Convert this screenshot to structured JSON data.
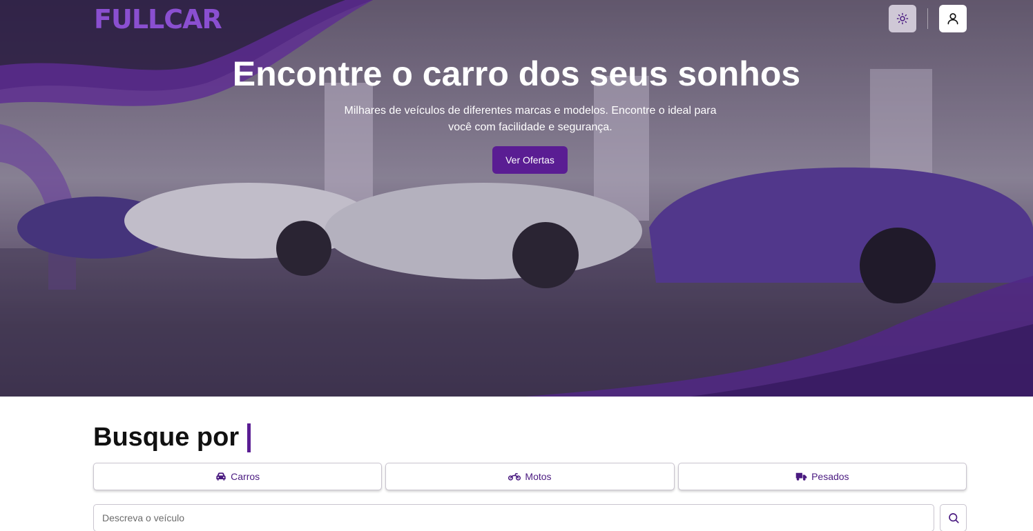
{
  "brand": {
    "logo_text": "FULLCAR"
  },
  "header": {
    "theme_icon": "sun-icon",
    "user_icon": "user-icon"
  },
  "hero": {
    "title": "Encontre o carro dos seus sonhos",
    "subtitle": "Milhares de veículos de diferentes marcas e modelos. Encontre o ideal para você com facilidade e segurança.",
    "cta_label": "Ver Ofertas"
  },
  "search": {
    "title": "Busque por",
    "tabs": [
      {
        "label": "Carros",
        "icon": "car-icon"
      },
      {
        "label": "Motos",
        "icon": "motorcycle-icon"
      },
      {
        "label": "Pesados",
        "icon": "truck-icon"
      }
    ],
    "placeholder": "Descreva o veículo",
    "button_icon": "search-icon"
  },
  "colors": {
    "accent": "#5a1d93",
    "logo": "#8a4fd0"
  }
}
